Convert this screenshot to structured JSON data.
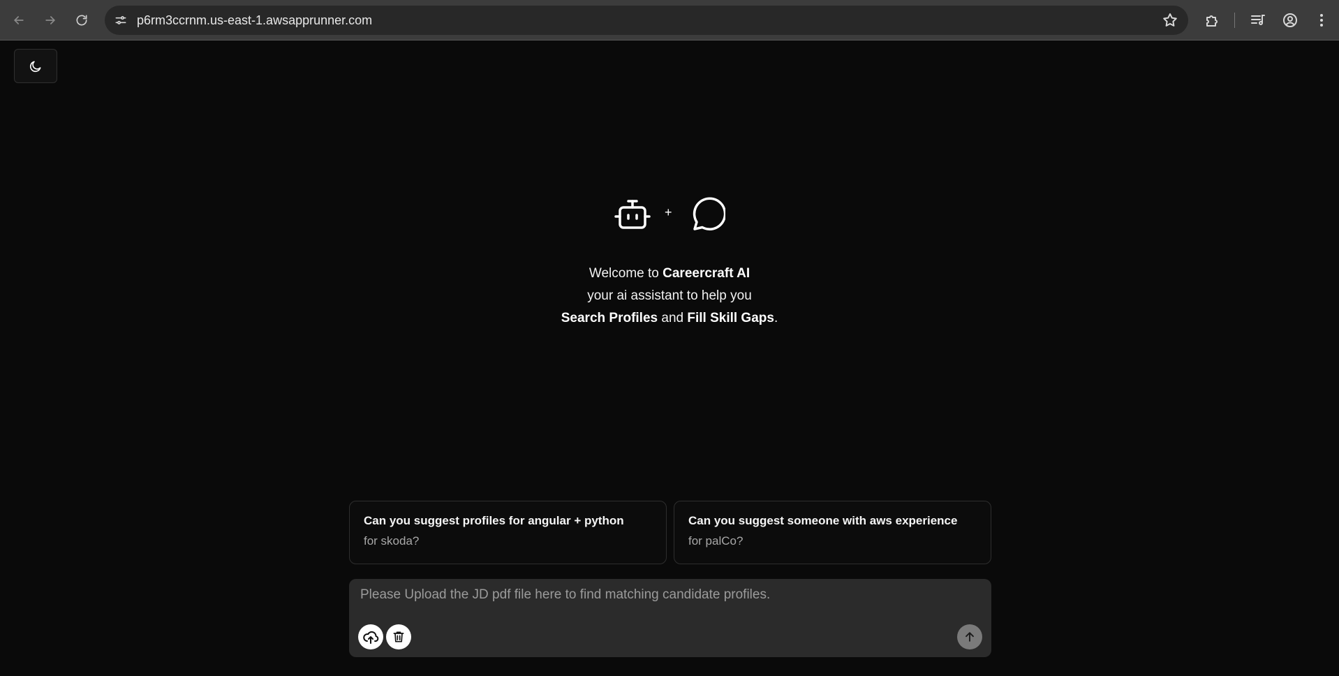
{
  "browser": {
    "url": "p6rm3ccrnm.us-east-1.awsapprunner.com",
    "icons": [
      "back-icon",
      "forward-icon",
      "reload-icon",
      "site-settings-icon",
      "bookmark-star-icon",
      "extensions-icon",
      "media-controls-icon",
      "profile-icon",
      "menu-dots-icon"
    ]
  },
  "page": {
    "theme_toggle_icon": "moon-icon",
    "hero": {
      "left_icon": "bot-icon",
      "plus": "+",
      "right_icon": "chat-bubble-icon"
    },
    "welcome": {
      "line1_prefix": "Welcome to ",
      "app_name": "Careercraft AI",
      "line2": "your ai assistant to help you",
      "feature1": "Search Profiles",
      "and": " and ",
      "feature2": "Fill Skill Gaps",
      "period": "."
    },
    "suggestions": [
      {
        "title": "Can you suggest profiles for angular + python",
        "subtitle": "for skoda?"
      },
      {
        "title": "Can you suggest someone with aws experience",
        "subtitle": "for palCo?"
      }
    ],
    "composer": {
      "placeholder": "Please Upload the JD pdf file here to find matching candidate profiles.",
      "value": "",
      "upload_icon": "cloud-upload-icon",
      "delete_icon": "trash-icon",
      "send_icon": "arrow-up-icon"
    }
  }
}
